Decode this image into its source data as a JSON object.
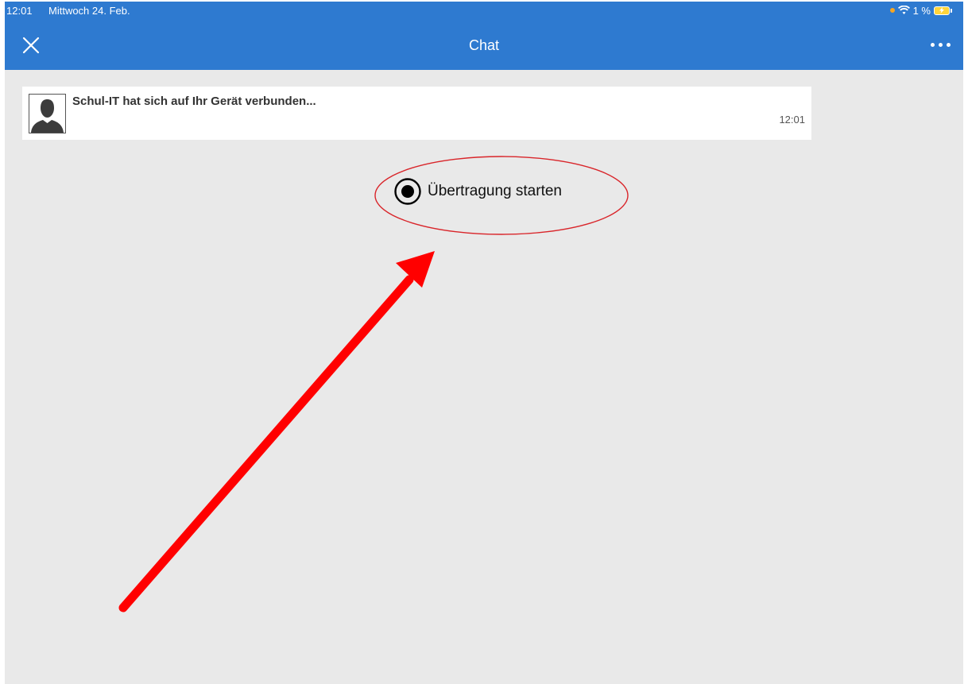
{
  "status_bar": {
    "time": "12:01",
    "date": "Mittwoch 24. Feb.",
    "battery": "1 %"
  },
  "header": {
    "title": "Chat",
    "close_icon": "close-icon",
    "more_icon": "more-icon"
  },
  "message": {
    "text": "Schul-IT hat sich auf Ihr Gerät verbunden...",
    "time": "12:01",
    "avatar_icon": "person-silhouette-icon"
  },
  "broadcast": {
    "label": "Übertragung starten",
    "icon": "record-icon"
  },
  "colors": {
    "header": "#2e7ad0",
    "background": "#e9e9e9",
    "annotation_arrow": "#ff0000",
    "annotation_ellipse": "#d9252a"
  }
}
